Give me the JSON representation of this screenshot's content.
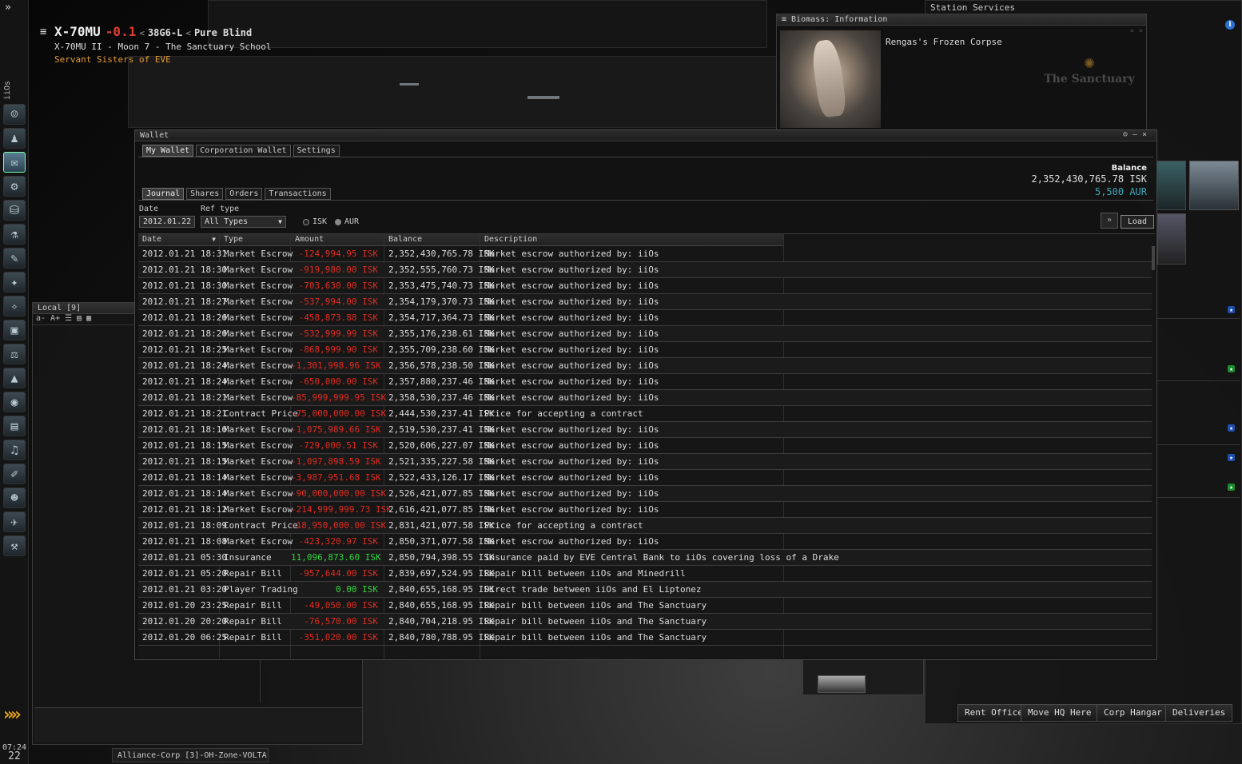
{
  "neocom": {
    "character": "iiOs",
    "time": "07:24",
    "day": "22"
  },
  "location": {
    "system": "X-70MU",
    "security": "-0.1",
    "constellation": "38G6-L",
    "region": "Pure Blind",
    "station": "X-70MU II - Moon 7 - The Sanctuary School",
    "corporation": "Servant Sisters of EVE"
  },
  "local": {
    "title": "Local [9]",
    "tools": [
      "a-",
      "A+"
    ]
  },
  "chat_tab": "Alliance-Corp [3]-OH-Zone-VOLTA ...",
  "info_window": {
    "title": "Biomass: Information",
    "item_name": "Rengas's Frozen Corpse",
    "corp_logo_text": "The Sanctuary"
  },
  "station_services": {
    "title": "Station Services",
    "buttons": [
      "Rent Office",
      "Move HQ Here",
      "Corp Hangar",
      "Deliveries"
    ]
  },
  "wallet": {
    "title": "Wallet",
    "top_tabs": [
      "My Wallet",
      "Corporation Wallet",
      "Settings"
    ],
    "sub_tabs": [
      "Journal",
      "Shares",
      "Orders",
      "Transactions"
    ],
    "balance_label": "Balance",
    "balance_isk": "2,352,430,765.78 ISK",
    "balance_aur": "5,500 AUR",
    "date_label": "Date",
    "date_value": "2012.01.22",
    "reftype_label": "Ref type",
    "reftype_value": "All Types",
    "radio_isk": "ISK",
    "radio_aur": "AUR",
    "load_label": "Load",
    "columns": [
      "Date",
      "Type",
      "Amount",
      "Balance",
      "Description"
    ]
  },
  "journal": [
    {
      "date": "2012.01.21 18:31",
      "type": "Market Escrow",
      "amount": "-124,994.95 ISK",
      "balance": "2,352,430,765.78 ISK",
      "description": "Market escrow authorized by: iiOs"
    },
    {
      "date": "2012.01.21 18:30",
      "type": "Market Escrow",
      "amount": "-919,980.00 ISK",
      "balance": "2,352,555,760.73 ISK",
      "description": "Market escrow authorized by: iiOs"
    },
    {
      "date": "2012.01.21 18:30",
      "type": "Market Escrow",
      "amount": "-703,630.00 ISK",
      "balance": "2,353,475,740.73 ISK",
      "description": "Market escrow authorized by: iiOs"
    },
    {
      "date": "2012.01.21 18:27",
      "type": "Market Escrow",
      "amount": "-537,994.00 ISK",
      "balance": "2,354,179,370.73 ISK",
      "description": "Market escrow authorized by: iiOs"
    },
    {
      "date": "2012.01.21 18:26",
      "type": "Market Escrow",
      "amount": "-458,873.88 ISK",
      "balance": "2,354,717,364.73 ISK",
      "description": "Market escrow authorized by: iiOs"
    },
    {
      "date": "2012.01.21 18:26",
      "type": "Market Escrow",
      "amount": "-532,999.99 ISK",
      "balance": "2,355,176,238.61 ISK",
      "description": "Market escrow authorized by: iiOs"
    },
    {
      "date": "2012.01.21 18:25",
      "type": "Market Escrow",
      "amount": "-868,999.90 ISK",
      "balance": "2,355,709,238.60 ISK",
      "description": "Market escrow authorized by: iiOs"
    },
    {
      "date": "2012.01.21 18:24",
      "type": "Market Escrow",
      "amount": "-1,301,998.96 ISK",
      "balance": "2,356,578,238.50 ISK",
      "description": "Market escrow authorized by: iiOs"
    },
    {
      "date": "2012.01.21 18:24",
      "type": "Market Escrow",
      "amount": "-650,000.00 ISK",
      "balance": "2,357,880,237.46 ISK",
      "description": "Market escrow authorized by: iiOs"
    },
    {
      "date": "2012.01.21 18:21",
      "type": "Market Escrow",
      "amount": "-85,999,999.95 ISK",
      "balance": "2,358,530,237.46 ISK",
      "description": "Market escrow authorized by: iiOs"
    },
    {
      "date": "2012.01.21 18:21",
      "type": "Contract Price",
      "amount": "-75,000,000.00 ISK",
      "balance": "2,444,530,237.41 ISK",
      "description": "Price for accepting a contract"
    },
    {
      "date": "2012.01.21 18:16",
      "type": "Market Escrow",
      "amount": "-1,075,989.66 ISK",
      "balance": "2,519,530,237.41 ISK",
      "description": "Market escrow authorized by: iiOs"
    },
    {
      "date": "2012.01.21 18:15",
      "type": "Market Escrow",
      "amount": "-729,000.51 ISK",
      "balance": "2,520,606,227.07 ISK",
      "description": "Market escrow authorized by: iiOs"
    },
    {
      "date": "2012.01.21 18:15",
      "type": "Market Escrow",
      "amount": "-1,097,898.59 ISK",
      "balance": "2,521,335,227.58 ISK",
      "description": "Market escrow authorized by: iiOs"
    },
    {
      "date": "2012.01.21 18:14",
      "type": "Market Escrow",
      "amount": "-3,987,951.68 ISK",
      "balance": "2,522,433,126.17 ISK",
      "description": "Market escrow authorized by: iiOs"
    },
    {
      "date": "2012.01.21 18:14",
      "type": "Market Escrow",
      "amount": "-90,000,000.00 ISK",
      "balance": "2,526,421,077.85 ISK",
      "description": "Market escrow authorized by: iiOs"
    },
    {
      "date": "2012.01.21 18:12",
      "type": "Market Escrow",
      "amount": "-214,999,999.73 ISK",
      "balance": "2,616,421,077.85 ISK",
      "description": "Market escrow authorized by: iiOs"
    },
    {
      "date": "2012.01.21 18:09",
      "type": "Contract Price",
      "amount": "-18,950,000.00 ISK",
      "balance": "2,831,421,077.58 ISK",
      "description": "Price for accepting a contract"
    },
    {
      "date": "2012.01.21 18:08",
      "type": "Market Escrow",
      "amount": "-423,320.97 ISK",
      "balance": "2,850,371,077.58 ISK",
      "description": "Market escrow authorized by: iiOs"
    },
    {
      "date": "2012.01.21 05:30",
      "type": "Insurance",
      "amount": "11,096,873.60 ISK",
      "balance": "2,850,794,398.55 ISK",
      "description": "Insurance paid by EVE Central Bank to iiOs covering loss of a Drake"
    },
    {
      "date": "2012.01.21 05:20",
      "type": "Repair Bill",
      "amount": "-957,644.00 ISK",
      "balance": "2,839,697,524.95 ISK",
      "description": "Repair bill between iiOs and Minedrill"
    },
    {
      "date": "2012.01.21 03:20",
      "type": "Player Trading",
      "amount": "0.00 ISK",
      "balance": "2,840,655,168.95 ISK",
      "description": "Direct trade between iiOs and El Liptonez"
    },
    {
      "date": "2012.01.20 23:25",
      "type": "Repair Bill",
      "amount": "-49,050.00 ISK",
      "balance": "2,840,655,168.95 ISK",
      "description": "Repair bill between iiOs and The Sanctuary"
    },
    {
      "date": "2012.01.20 20:20",
      "type": "Repair Bill",
      "amount": "-76,570.00 ISK",
      "balance": "2,840,704,218.95 ISK",
      "description": "Repair bill between iiOs and The Sanctuary"
    },
    {
      "date": "2012.01.20 06:25",
      "type": "Repair Bill",
      "amount": "-351,020.00 ISK",
      "balance": "2,840,780,788.95 ISK",
      "description": "Repair bill between iiOs and The Sanctuary"
    }
  ],
  "colors": {
    "negative": "#e02b20",
    "positive": "#2fd53b",
    "aur": "#3fa6b9",
    "security_low": "#e23b2f",
    "corp": "#e39a32"
  }
}
